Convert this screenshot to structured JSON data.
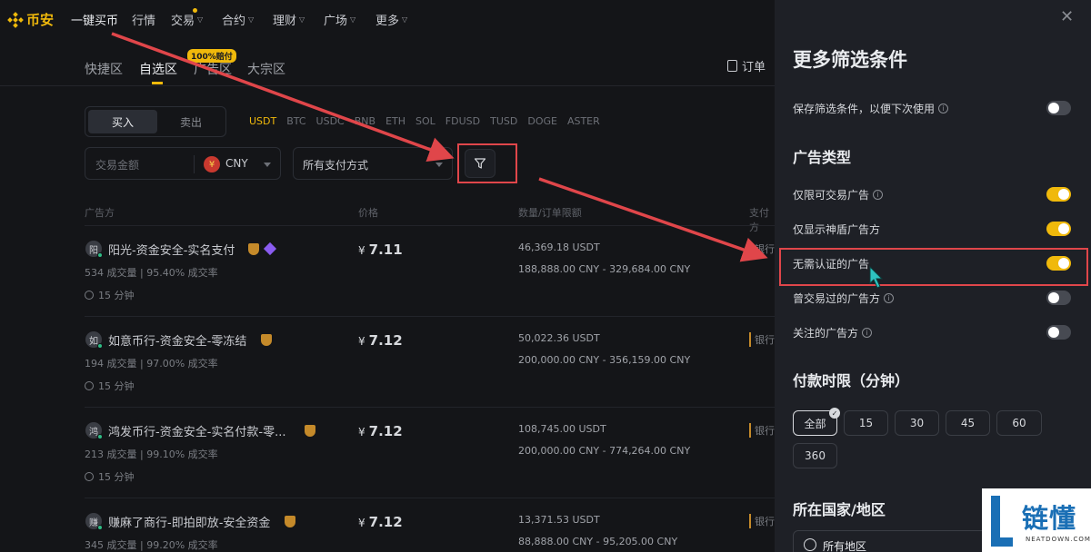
{
  "brand": {
    "name": "币安"
  },
  "nav": [
    {
      "label": "一键买币",
      "chev": false,
      "active": true
    },
    {
      "label": "行情",
      "chev": false
    },
    {
      "label": "交易",
      "chev": true,
      "dot": true
    },
    {
      "label": "合约",
      "chev": true
    },
    {
      "label": "理财",
      "chev": true
    },
    {
      "label": "广场",
      "chev": true
    },
    {
      "label": "更多",
      "chev": true
    }
  ],
  "tabs": [
    {
      "label": "快捷区"
    },
    {
      "label": "自选区",
      "active": true
    },
    {
      "label": "广告区"
    },
    {
      "label": "大宗区"
    }
  ],
  "tab_badge": "100%赔付",
  "orders_label": "订单",
  "trade": {
    "buy_label": "买入",
    "sell_label": "卖出",
    "coins": [
      "USDT",
      "BTC",
      "USDC",
      "BNB",
      "ETH",
      "SOL",
      "FDUSD",
      "TUSD",
      "DOGE",
      "ASTER"
    ],
    "active_coin": "USDT",
    "amount_placeholder": "交易金额",
    "currency": "CNY",
    "currency_symbol": "¥",
    "payment_method": "所有支付方式"
  },
  "columns": {
    "advertiser": "广告方",
    "price": "价格",
    "quantity": "数量/订单限额",
    "payment": "支付方"
  },
  "ads": [
    {
      "avatar": "阳",
      "name": "阳光-资金安全-实名支付",
      "trades": "534 成交量",
      "rate": "95.40% 成交率",
      "time": "15 分钟",
      "price": "7.11",
      "qty": "46,369.18 USDT",
      "limit": "188,888.00 CNY - 329,684.00 CNY",
      "payment": "银行",
      "diamond": true
    },
    {
      "avatar": "如",
      "name": "如意币行-资金安全-零冻结",
      "trades": "194 成交量",
      "rate": "97.00% 成交率",
      "time": "15 分钟",
      "price": "7.12",
      "qty": "50,022.36 USDT",
      "limit": "200,000.00 CNY - 356,159.00 CNY",
      "payment": "银行"
    },
    {
      "avatar": "鸿",
      "name": "鸿发币行-资金安全-实名付款-零...",
      "trades": "213 成交量",
      "rate": "99.10% 成交率",
      "time": "15 分钟",
      "price": "7.12",
      "qty": "108,745.00 USDT",
      "limit": "200,000.00 CNY - 774,264.00 CNY",
      "payment": "银行"
    },
    {
      "avatar": "赚",
      "name": "赚麻了商行-即拍即放-安全资金",
      "trades": "345 成交量",
      "rate": "99.20% 成交率",
      "time": "",
      "price": "7.12",
      "qty": "13,371.53 USDT",
      "limit": "88,888.00 CNY - 95,205.00 CNY",
      "payment": "银行"
    }
  ],
  "panel": {
    "title": "更多筛选条件",
    "save_filter_label": "保存筛选条件，以便下次使用",
    "save_filter_on": false,
    "ad_type_heading": "广告类型",
    "options": [
      {
        "label": "仅限可交易广告",
        "info": true,
        "on": true
      },
      {
        "label": "仅显示神盾广告方",
        "info": false,
        "on": true
      },
      {
        "label": "无需认证的广告",
        "info": false,
        "on": true,
        "highlighted": true
      },
      {
        "label": "曾交易过的广告方",
        "info": true,
        "on": false
      },
      {
        "label": "关注的广告方",
        "info": true,
        "on": false
      }
    ],
    "payment_time_heading": "付款时限（分钟）",
    "payment_times": [
      "全部",
      "15",
      "30",
      "45",
      "60",
      "360"
    ],
    "payment_time_selected": "全部",
    "region_heading": "所在国家/地区",
    "region_value": "所有地区"
  },
  "watermark": {
    "text": "链懂",
    "sub": "NEATDOWN.COM"
  },
  "colors": {
    "accent": "#f0b90b",
    "annotation": "#e0464a",
    "panel_bg": "#1e2026",
    "page_bg": "#141518"
  }
}
